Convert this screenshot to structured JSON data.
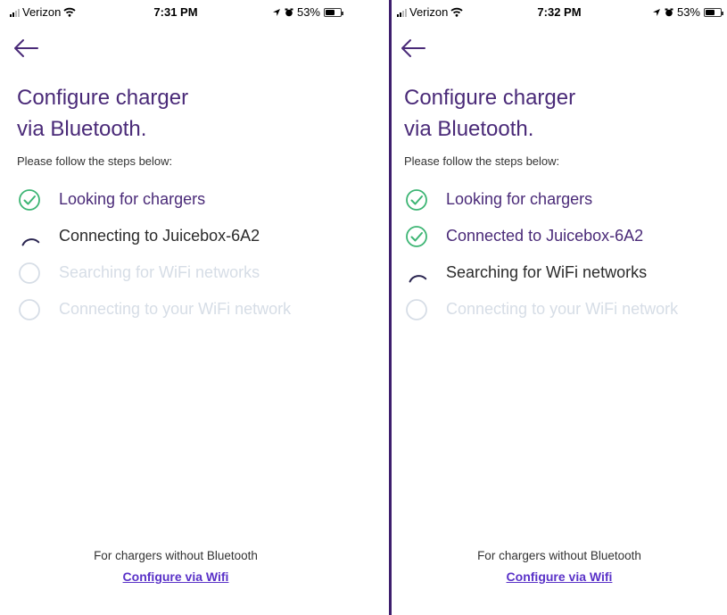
{
  "colors": {
    "accent": "#4a2a78",
    "check_green": "#3db574",
    "pending_gray": "#d6dde6",
    "link": "#5a32c8"
  },
  "screens": [
    {
      "status": {
        "carrier": "Verizon",
        "time": "7:31 PM",
        "battery": "53%"
      },
      "title_line1": "Configure charger",
      "title_line2": "via Bluetooth.",
      "subtitle": "Please follow the steps below:",
      "steps": [
        {
          "label": "Looking for chargers",
          "state": "done",
          "icon": "check-circle-icon"
        },
        {
          "label": "Connecting to Juicebox-6A2",
          "state": "active",
          "icon": "spinner-icon"
        },
        {
          "label": "Searching for WiFi networks",
          "state": "pending",
          "icon": "empty-circle-icon"
        },
        {
          "label": "Connecting to your WiFi network",
          "state": "pending",
          "icon": "empty-circle-icon"
        }
      ],
      "footer_text": "For chargers without Bluetooth",
      "footer_link": "Configure via Wifi"
    },
    {
      "status": {
        "carrier": "Verizon",
        "time": "7:32 PM",
        "battery": "53%"
      },
      "title_line1": "Configure charger",
      "title_line2": "via Bluetooth.",
      "subtitle": "Please follow the steps below:",
      "steps": [
        {
          "label": "Looking for chargers",
          "state": "done",
          "icon": "check-circle-icon"
        },
        {
          "label": "Connected to Juicebox-6A2",
          "state": "done",
          "icon": "check-circle-icon"
        },
        {
          "label": "Searching for WiFi networks",
          "state": "active",
          "icon": "spinner-icon"
        },
        {
          "label": "Connecting to your WiFi network",
          "state": "pending",
          "icon": "empty-circle-icon"
        }
      ],
      "footer_text": "For chargers without Bluetooth",
      "footer_link": "Configure via Wifi"
    }
  ]
}
